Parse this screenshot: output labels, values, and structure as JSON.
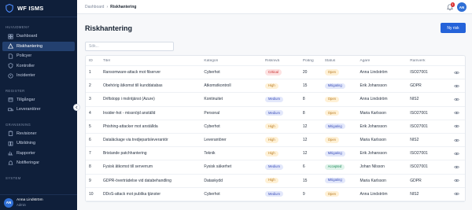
{
  "app": {
    "name": "WF ISMS"
  },
  "sidebar": {
    "sections": [
      {
        "title": "HUVUDMENY",
        "items": [
          {
            "label": "Dashboard",
            "icon": "grid-icon",
            "active": false
          },
          {
            "label": "Riskhantering",
            "icon": "alert-icon",
            "active": true
          },
          {
            "label": "Policyer",
            "icon": "document-icon",
            "active": false
          },
          {
            "label": "Kontroller",
            "icon": "shield-icon",
            "active": false
          },
          {
            "label": "Incidenter",
            "icon": "warning-icon",
            "active": false
          }
        ]
      },
      {
        "title": "REGISTER",
        "items": [
          {
            "label": "Tillgångar",
            "icon": "box-icon",
            "active": false
          },
          {
            "label": "Leverantörer",
            "icon": "truck-icon",
            "active": false
          }
        ]
      },
      {
        "title": "GRANSKNING",
        "items": [
          {
            "label": "Revisioner",
            "icon": "clipboard-icon",
            "active": false
          },
          {
            "label": "Utbildning",
            "icon": "book-icon",
            "active": false
          },
          {
            "label": "Rapporter",
            "icon": "chart-icon",
            "active": false
          },
          {
            "label": "Notifieringar",
            "icon": "bell-icon",
            "active": false
          }
        ]
      },
      {
        "title": "SYSTEM",
        "items": []
      }
    ],
    "user": {
      "initials": "AN",
      "name": "Anna Lindström",
      "role": "Admin"
    }
  },
  "topbar": {
    "breadcrumb": [
      "Dashboard",
      "Riskhantering"
    ],
    "separator": "›",
    "notifications": "3",
    "avatar_initials": "AN"
  },
  "page": {
    "title": "Riskhantering",
    "new_button": "Ny risk",
    "search_placeholder": "Sök..."
  },
  "colors": {
    "accent": "#2563d9",
    "sidebar": "#0f1f3a",
    "level": {
      "Critical": {
        "bg": "#fde2e2",
        "fg": "#c62828"
      },
      "High": {
        "bg": "#fff1d6",
        "fg": "#b7791f"
      },
      "Medium": {
        "bg": "#e3e8fb",
        "fg": "#3b4fb8"
      }
    },
    "status": {
      "Open": {
        "bg": "#fff1d6",
        "fg": "#b7791f"
      },
      "Mitigating": {
        "bg": "#e3e8fb",
        "fg": "#3b4fb8"
      },
      "Accepted": {
        "bg": "#dff3ea",
        "fg": "#1f8a5a"
      }
    }
  },
  "table": {
    "columns": [
      "ID",
      "Titel",
      "Kategori",
      "Risknivå",
      "Poäng",
      "Status",
      "Ägare",
      "Ramverk"
    ],
    "rows": [
      {
        "id": "1",
        "title": "Ransomware-attack mot filserver",
        "category": "Cyberhot",
        "level": "Critical",
        "score": "20",
        "status": "Open",
        "owner": "Anna Lindström",
        "framework": "ISO27001"
      },
      {
        "id": "2",
        "title": "Obehörig åtkomst till kunddatabas",
        "category": "Åtkomstkontroll",
        "level": "High",
        "score": "15",
        "status": "Mitigating",
        "owner": "Erik Johansson",
        "framework": "GDPR"
      },
      {
        "id": "3",
        "title": "Driftstopp i molntjänst (Azure)",
        "category": "Kontinuitet",
        "level": "Medium",
        "score": "8",
        "status": "Open",
        "owner": "Anna Lindström",
        "framework": "NIS2"
      },
      {
        "id": "4",
        "title": "Insider-hot - missnöjd anställd",
        "category": "Personal",
        "level": "Medium",
        "score": "8",
        "status": "Open",
        "owner": "Maria Karlsson",
        "framework": "ISO27001"
      },
      {
        "id": "5",
        "title": "Phishing-attacker mot anställda",
        "category": "Cyberhot",
        "level": "High",
        "score": "12",
        "status": "Mitigating",
        "owner": "Erik Johansson",
        "framework": "ISO27001"
      },
      {
        "id": "6",
        "title": "Dataläckage via tredjepartsleverantör",
        "category": "Leverantörer",
        "level": "High",
        "score": "12",
        "status": "Open",
        "owner": "Maria Karlsson",
        "framework": "NIS2"
      },
      {
        "id": "7",
        "title": "Bristande patchhantering",
        "category": "Teknik",
        "level": "High",
        "score": "12",
        "status": "Mitigating",
        "owner": "Erik Johansson",
        "framework": "ISO27001"
      },
      {
        "id": "8",
        "title": "Fysisk åtkomst till serverrum",
        "category": "Fysisk säkerhet",
        "level": "Medium",
        "score": "6",
        "status": "Accepted",
        "owner": "Johan Nilsson",
        "framework": "ISO27001"
      },
      {
        "id": "9",
        "title": "GDPR-överträdelse vid databehandling",
        "category": "Dataskydd",
        "level": "High",
        "score": "15",
        "status": "Mitigating",
        "owner": "Maria Karlsson",
        "framework": "GDPR"
      },
      {
        "id": "10",
        "title": "DDoS-attack mot publika tjänster",
        "category": "Cyberhot",
        "level": "Medium",
        "score": "9",
        "status": "Open",
        "owner": "Anna Lindström",
        "framework": "NIS2"
      }
    ]
  }
}
